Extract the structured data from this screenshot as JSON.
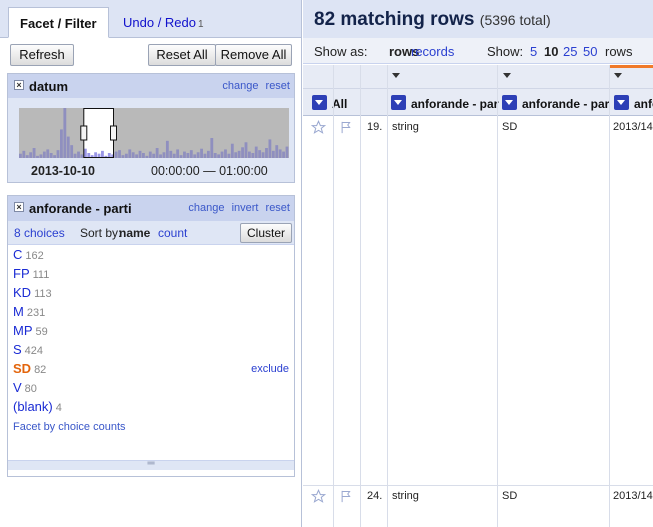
{
  "left": {
    "tabs": [
      {
        "label": "Facet / Filter"
      },
      {
        "label": "Undo / Redo",
        "count": "1"
      }
    ],
    "buttons": {
      "refresh": "Refresh",
      "reset_all": "Reset All",
      "remove_all": "Remove All"
    },
    "time_facet": {
      "close": "×",
      "title": "datum",
      "links": [
        "change",
        "reset"
      ],
      "date": "2013-10-10",
      "time_range": "00:00:00 — 01:00:00",
      "histogram": {
        "type": "bar",
        "bins": [
          6,
          10,
          4,
          8,
          14,
          3,
          5,
          9,
          12,
          7,
          4,
          11,
          40,
          70,
          30,
          18,
          6,
          9,
          5,
          13,
          7,
          4,
          8,
          6,
          10,
          3,
          7,
          5,
          9,
          11,
          4,
          6,
          12,
          8,
          5,
          10,
          7,
          3,
          9,
          6,
          14,
          5,
          8,
          24,
          10,
          6,
          12,
          4,
          9,
          7,
          11,
          5,
          8,
          13,
          6,
          10,
          28,
          7,
          5,
          9,
          12,
          6,
          20,
          8,
          10,
          15,
          22,
          9,
          7,
          16,
          11,
          8,
          14,
          26,
          10,
          18,
          12,
          9,
          16
        ],
        "selection_fraction": [
          0.24,
          0.35
        ]
      }
    },
    "list_facet": {
      "close": "×",
      "title": "anforande - parti",
      "links": [
        "change",
        "invert",
        "reset"
      ],
      "choices_count": "8 choices",
      "sort_by": "Sort by:",
      "sort_name": "name",
      "sort_count": "count",
      "cluster": "Cluster",
      "choices": [
        {
          "label": "C",
          "count": "162"
        },
        {
          "label": "FP",
          "count": "111"
        },
        {
          "label": "KD",
          "count": "113"
        },
        {
          "label": "M",
          "count": "231"
        },
        {
          "label": "MP",
          "count": "59"
        },
        {
          "label": "S",
          "count": "424"
        },
        {
          "label": "SD",
          "count": "82",
          "selected": true
        },
        {
          "label": "V",
          "count": "80"
        },
        {
          "label": "(blank)",
          "count": "4"
        }
      ],
      "exclude": "exclude",
      "facet_by_counts": "Facet by choice counts",
      "resize": "═"
    }
  },
  "right": {
    "summary": {
      "title": "82 matching rows",
      "total": "(5396 total)"
    },
    "view": {
      "show_as": "Show as:",
      "rows": "rows",
      "records": "records",
      "show": "Show:",
      "page_sizes": [
        "5",
        "10",
        "25",
        "50"
      ],
      "rows_suffix": "rows"
    },
    "columns": [
      {
        "label": "All"
      },
      {
        "label": "anforande - part"
      },
      {
        "label": "anforande - part"
      },
      {
        "label": "anfo"
      }
    ],
    "rows": [
      {
        "index": "19.",
        "c1": "string",
        "c2": "SD",
        "c3": "2013/14"
      },
      {
        "index": "24.",
        "c1": "string",
        "c2": "SD",
        "c3": "2013/14"
      }
    ],
    "accent_color": "#f07a2a"
  }
}
